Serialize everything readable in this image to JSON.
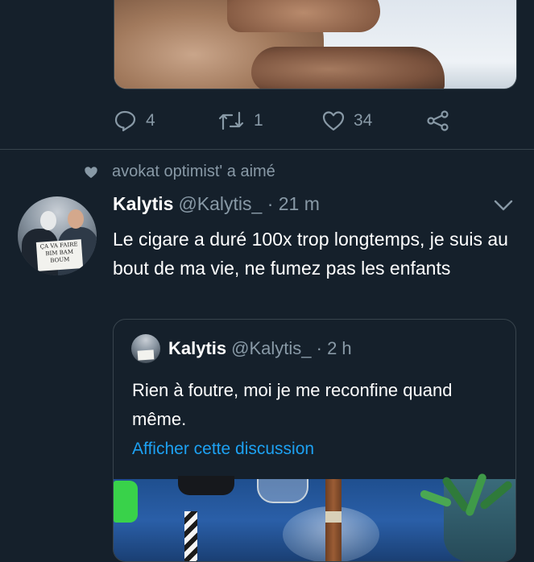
{
  "prev_tweet": {
    "actions": {
      "reply_count": "4",
      "retweet_count": "1",
      "like_count": "34"
    }
  },
  "liked_context": {
    "text": "avokat optimist' a aimé"
  },
  "tweet": {
    "avatar_sign_text": "ÇA VA FAIRE BIM BAM BOUM",
    "author_name": "Kalytis",
    "handle_time": "@Kalytis_ · 21 m",
    "text": "Le cigare a duré 100x trop longtemps, je suis au bout de ma vie, ne fumez pas les enfants",
    "quoted": {
      "author_name": "Kalytis",
      "handle_time": "@Kalytis_ · 2 h",
      "text": "Rien à foutre, moi je me reconfine quand même.",
      "link": "Afficher cette discussion"
    }
  },
  "colors": {
    "background": "#15202b",
    "secondary_text": "#8899a6",
    "link": "#1da1f2",
    "border": "#38444d"
  },
  "icons": [
    "reply-icon",
    "retweet-icon",
    "heart-icon",
    "share-icon",
    "chevron-down-icon"
  ]
}
